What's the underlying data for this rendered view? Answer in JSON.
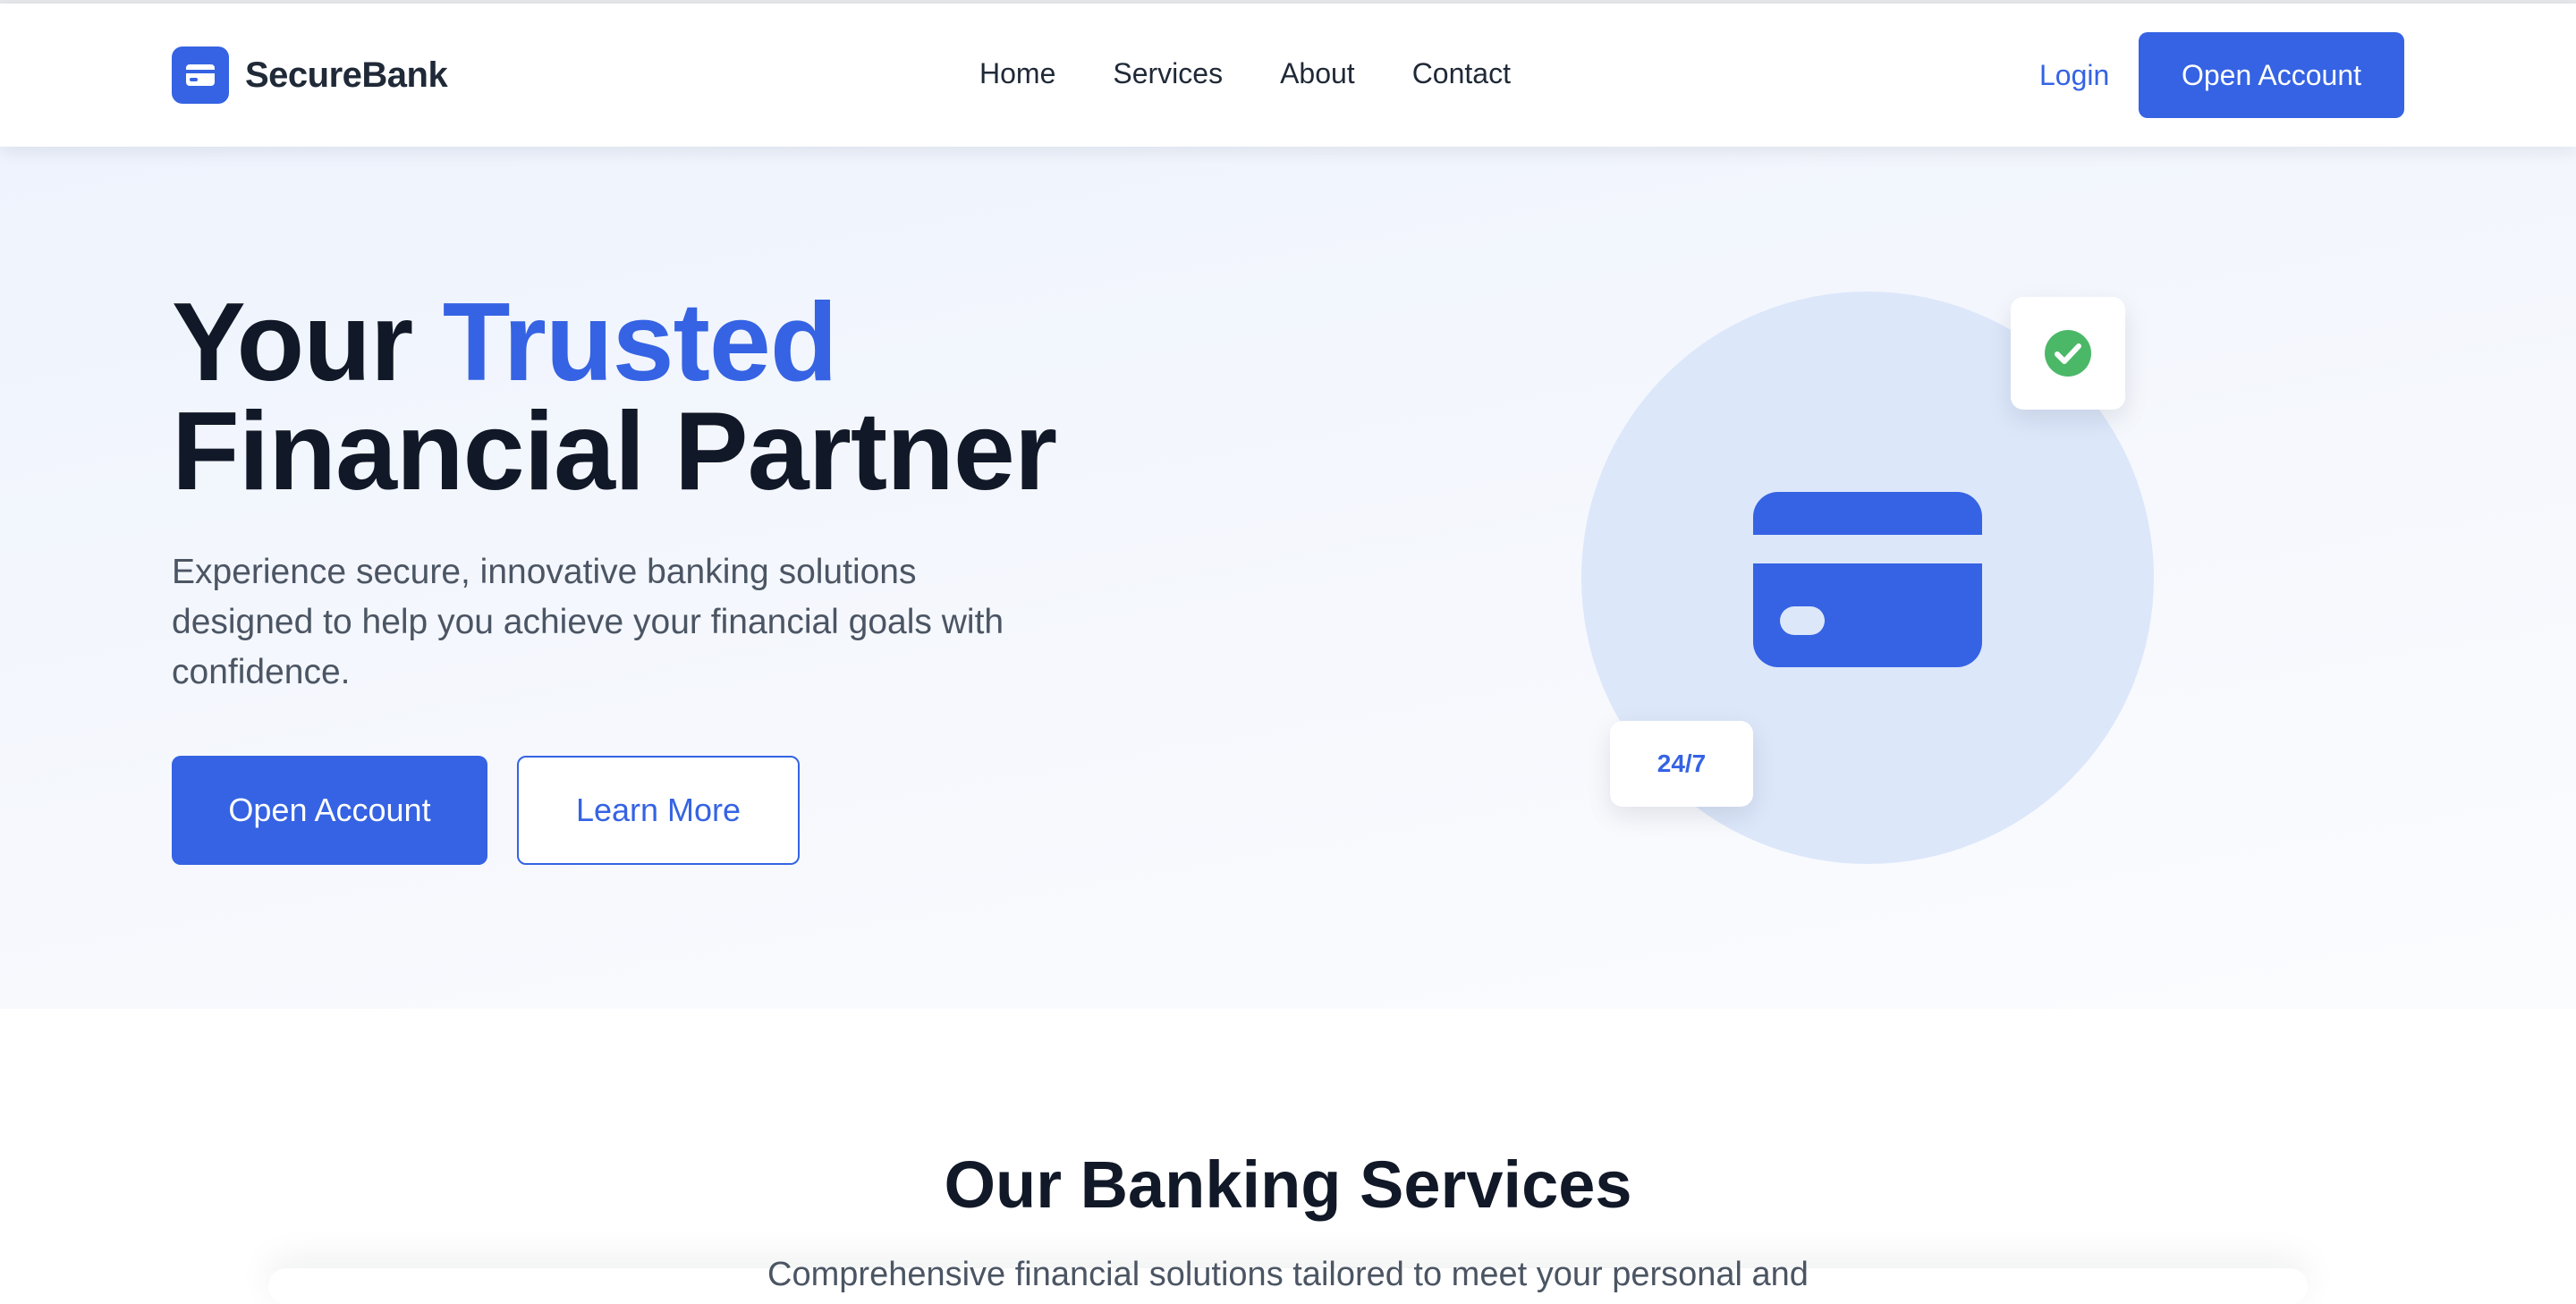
{
  "brand": {
    "name": "SecureBank",
    "logo_icon": "credit-card-icon",
    "color": "#3563e3"
  },
  "nav": {
    "links": [
      "Home",
      "Services",
      "About",
      "Contact"
    ],
    "login": "Login",
    "cta": "Open Account"
  },
  "hero": {
    "title_part1": "Your ",
    "title_accent": "Trusted",
    "title_line2": "Financial Partner",
    "subtitle": "Experience secure, innovative banking solutions designed to help you achieve your financial goals with confidence.",
    "primary_button": "Open Account",
    "secondary_button": "Learn More",
    "illustration": {
      "main_icon": "credit-card-icon",
      "check_badge_icon": "check-circle-icon",
      "availability_badge": "24/7"
    }
  },
  "services": {
    "title": "Our Banking Services",
    "subtitle": "Comprehensive financial solutions tailored to meet your personal and"
  },
  "colors": {
    "primary": "#3563e3",
    "dark_text": "#111827",
    "muted_text": "#4b5563",
    "success": "#4bb868"
  }
}
